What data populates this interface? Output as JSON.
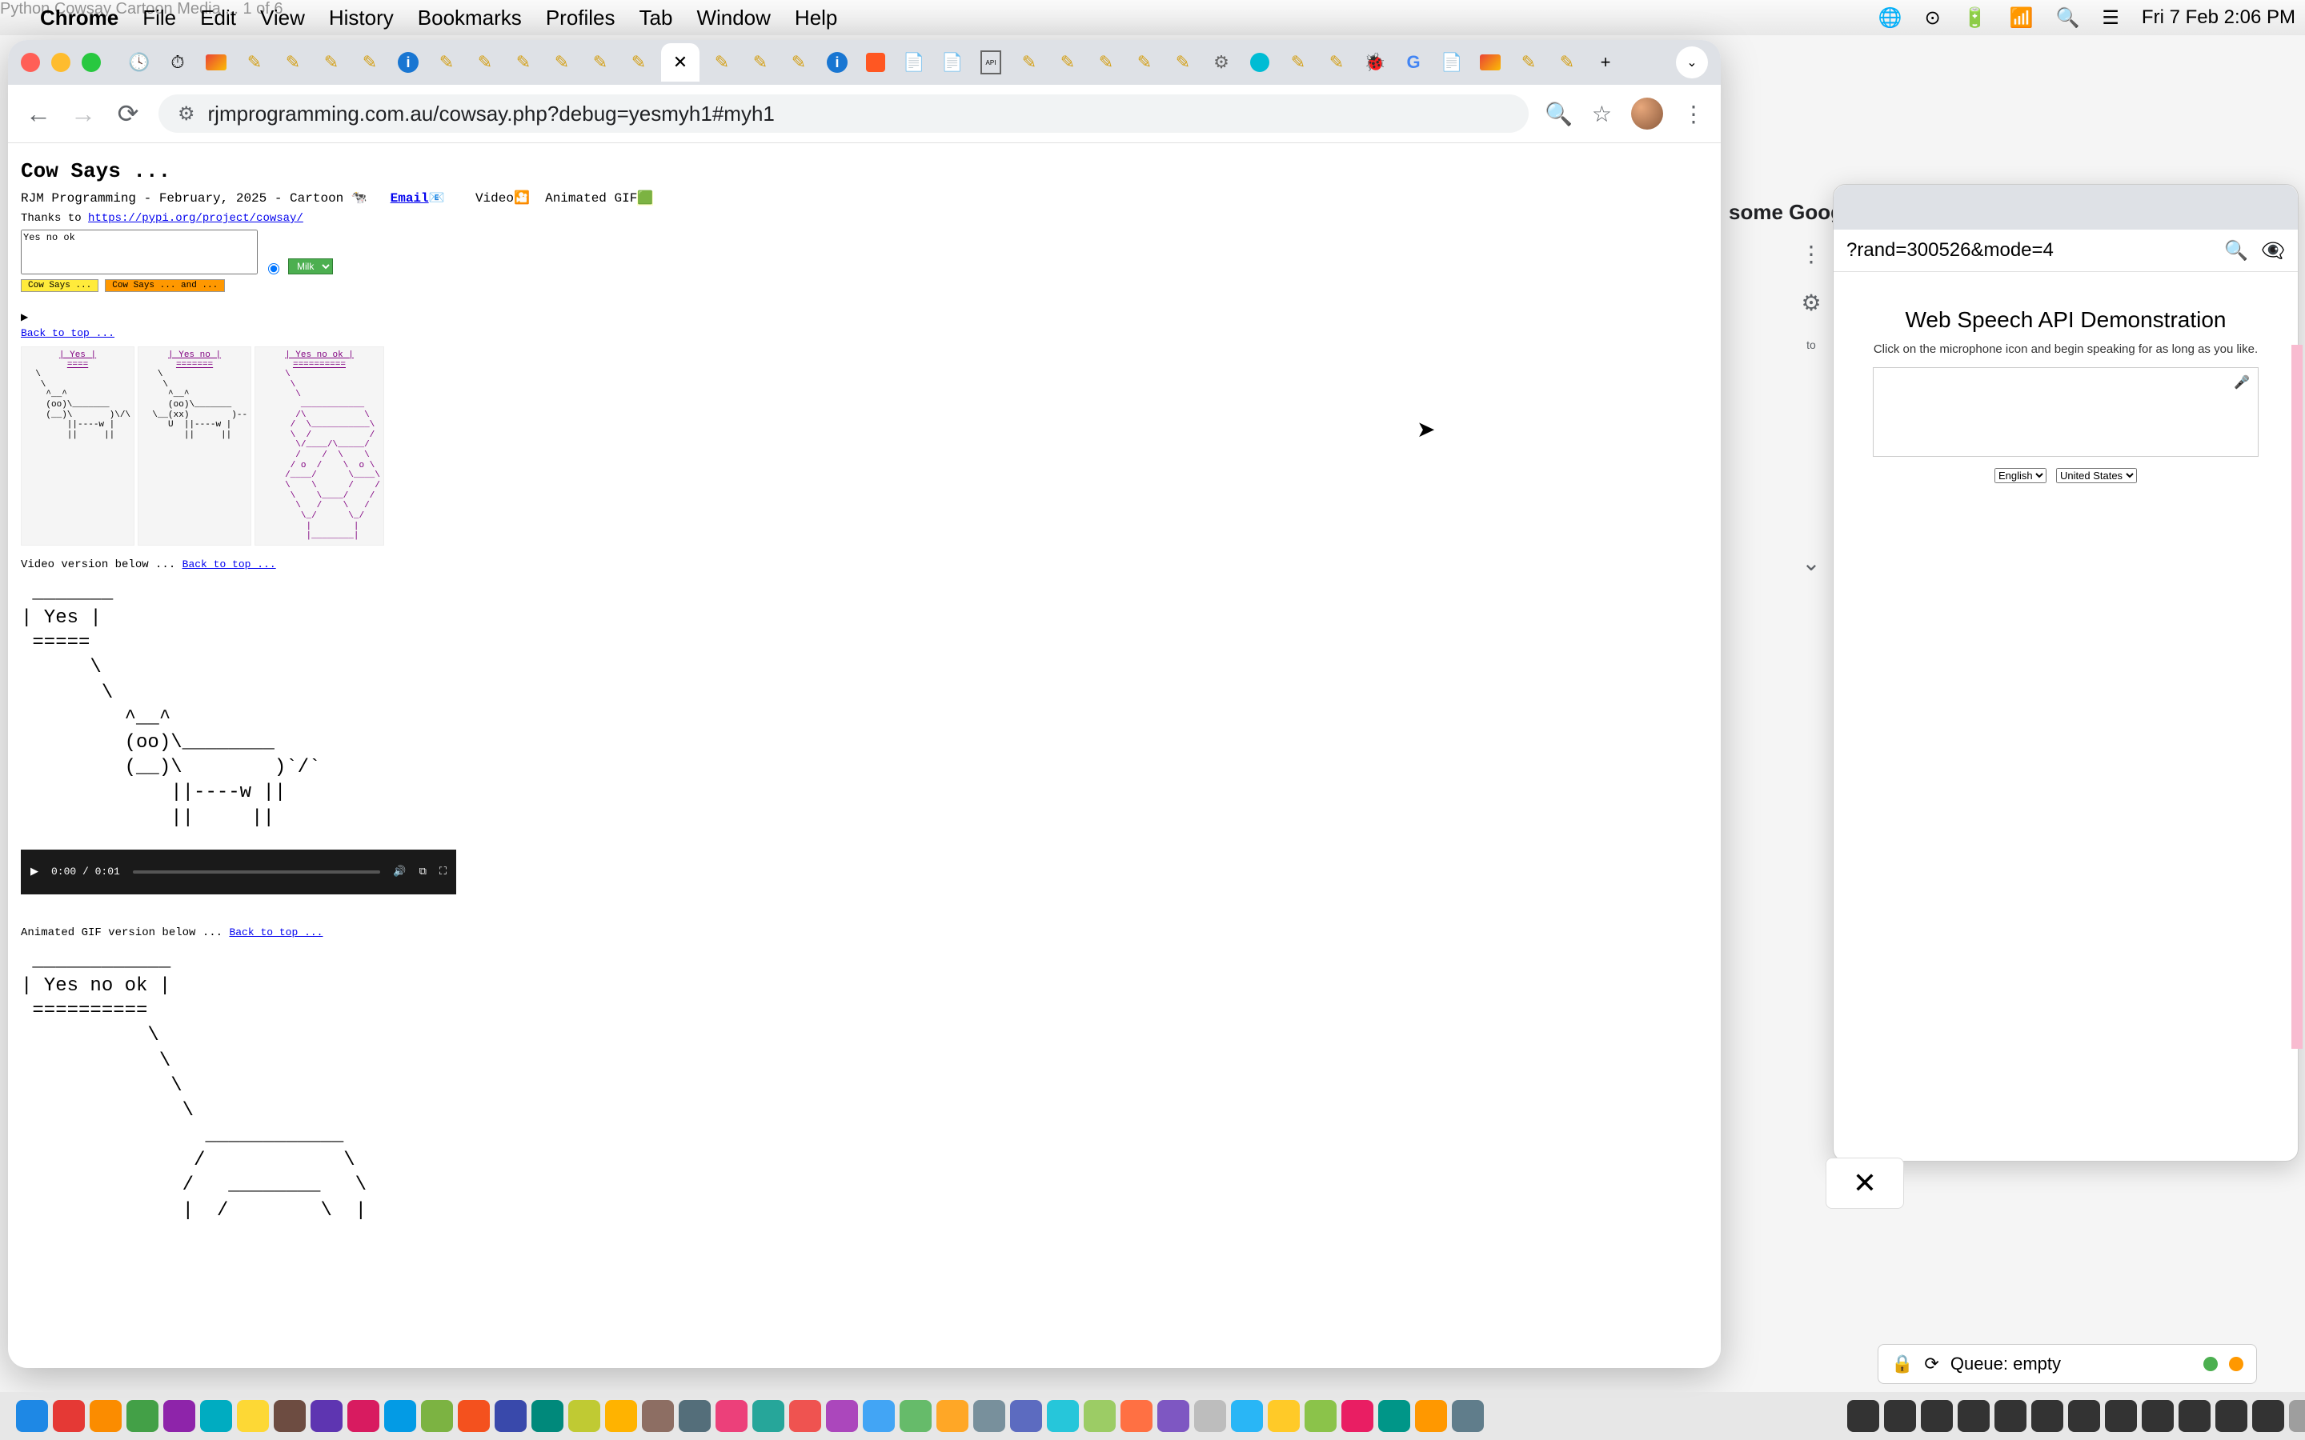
{
  "menubar": {
    "faded_text": "Python Cowsay Cartoon Media ... 1 of 6",
    "app": "Chrome",
    "items": [
      "File",
      "Edit",
      "View",
      "History",
      "Bookmarks",
      "Profiles",
      "Tab",
      "Window",
      "Help"
    ],
    "clock": "Fri 7 Feb  2:06 PM"
  },
  "chrome": {
    "url": "rjmprogramming.com.au/cowsay.php?debug=yesmyh1#myh1",
    "tab_close_glyph": "✕",
    "new_tab_glyph": "+",
    "dropdown_glyph": "⌄"
  },
  "page": {
    "title": "Cow Says ...",
    "subtitle_prefix": "RJM Programming - February, 2025 - Cartoon",
    "email_label": "Email",
    "video_label": "Video",
    "animated_label": "Animated GIF",
    "thanks_prefix": "Thanks to ",
    "thanks_link": "https://pypi.org/project/cowsay/",
    "textarea_value": "Yes no ok",
    "mode_select": "Milk",
    "btn_cow": "Cow Says ...",
    "btn_and": "Cow Says ... and ...",
    "arrow": "▶",
    "back_top": "Back to top ...",
    "cells": [
      {
        "caption": "| Yes |",
        "sub": "===="
      },
      {
        "caption": "| Yes no |",
        "sub": "======="
      },
      {
        "caption": "| Yes no ok |",
        "sub": "=========="
      }
    ],
    "video_label_section": "Video version below ... ",
    "big_cow_caption": "| Yes |",
    "big_cow_sub": "=====",
    "video_time": "0:00 / 0:01",
    "gif_label_section": "Animated GIF version below ... ",
    "gif_caption": "| Yes no ok |",
    "gif_sub": "=========="
  },
  "speech_window": {
    "partial_tab_title": "some Google Chrome web browsers)",
    "url_fragment": "?rand=300526&mode=4",
    "title": "Web Speech API Demonstration",
    "hint": "Click on the microphone icon and begin speaking for as long as you like.",
    "select1": "English",
    "select2": "United States",
    "close_glyph": "✕",
    "side_label": "to"
  },
  "queue": {
    "label": "Queue: empty"
  },
  "dock_colors": [
    "#1e88e5",
    "#e53935",
    "#fb8c00",
    "#43a047",
    "#8e24aa",
    "#00acc1",
    "#fdd835",
    "#6d4c41",
    "#5e35b1",
    "#d81b60",
    "#039be5",
    "#7cb342",
    "#f4511e",
    "#3949ab",
    "#00897b",
    "#c0ca33",
    "#ffb300",
    "#8d6e63",
    "#546e7a",
    "#ec407a",
    "#26a69a",
    "#ef5350",
    "#ab47bc",
    "#42a5f5",
    "#66bb6a",
    "#ffa726",
    "#78909c",
    "#5c6bc0",
    "#26c6da",
    "#9ccc65",
    "#ff7043",
    "#7e57c2",
    "#bdbdbd",
    "#29b6f6",
    "#ffca28",
    "#8bc34a",
    "#e91e63",
    "#009688",
    "#ff9800",
    "#607d8b"
  ]
}
